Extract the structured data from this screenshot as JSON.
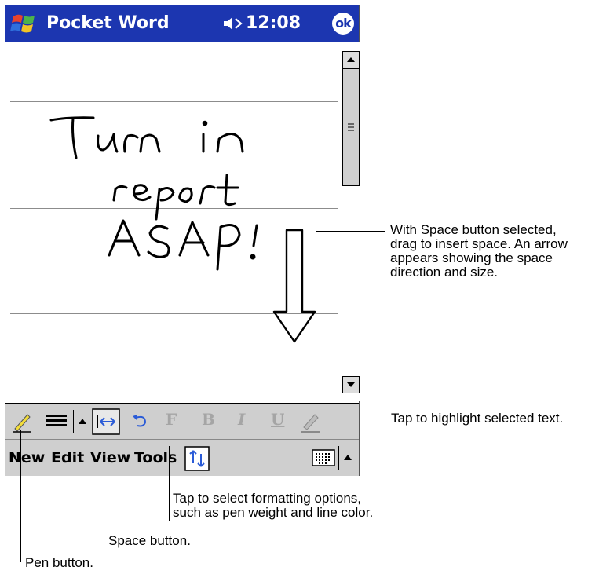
{
  "app": {
    "title": "Pocket Word",
    "clock": "12:08",
    "ok_label": "ok"
  },
  "menu": [
    "New",
    "Edit",
    "View",
    "Tools"
  ],
  "handwriting": [
    "Turn in",
    "report",
    "ASAP!"
  ],
  "callouts": {
    "space_drag": [
      "With Space button selected,",
      "drag to insert space. An arrow",
      "appears showing the space",
      "direction and size."
    ],
    "highlight": "Tap to highlight selected text.",
    "formatting": [
      "Tap to select formatting options,",
      "such as pen weight and line color."
    ],
    "space_button": "Space button.",
    "pen_button": "Pen button."
  },
  "toolbar": {
    "format_glyph": "F",
    "bold_glyph": "B",
    "italic_glyph": "I",
    "underline_glyph": "U"
  },
  "colors": {
    "titlebar": "#1c36b0",
    "toolbar": "#cfcfcf"
  }
}
